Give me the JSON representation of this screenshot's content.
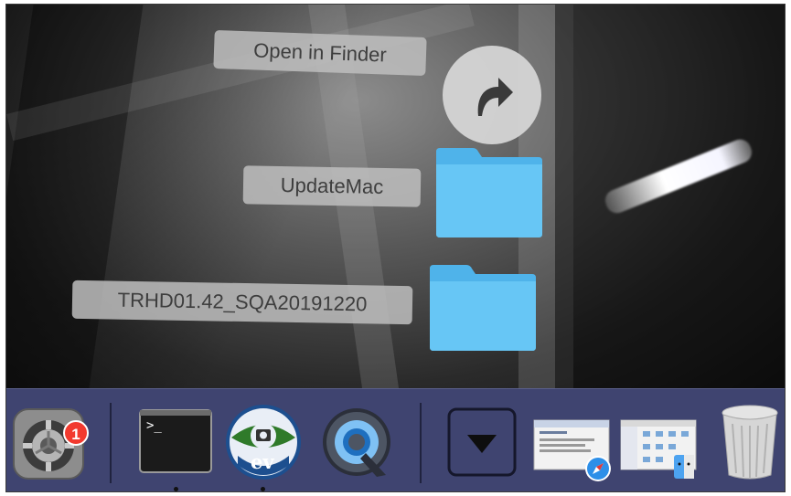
{
  "stack": {
    "open_in_finder_label": "Open in Finder",
    "items": [
      {
        "label": "UpdateMac",
        "icon": "folder-icon"
      },
      {
        "label": "TRHD01.42_SQA20191220",
        "icon": "folder-icon"
      }
    ]
  },
  "dock": {
    "apps": [
      {
        "name": "system-preferences-icon",
        "badge": "1"
      },
      {
        "name": "terminal-icon",
        "prompt": ">_"
      },
      {
        "name": "evocam-icon",
        "text": "ev"
      },
      {
        "name": "quicktime-icon"
      },
      {
        "name": "downloads-stack-icon"
      },
      {
        "name": "safari-screenshot-icon"
      },
      {
        "name": "finder-screenshot-icon"
      },
      {
        "name": "trash-icon"
      }
    ]
  },
  "colors": {
    "dock_bg": "#3f4470",
    "folder_blue": "#5bc1f2",
    "badge_red": "#f23a2f"
  }
}
